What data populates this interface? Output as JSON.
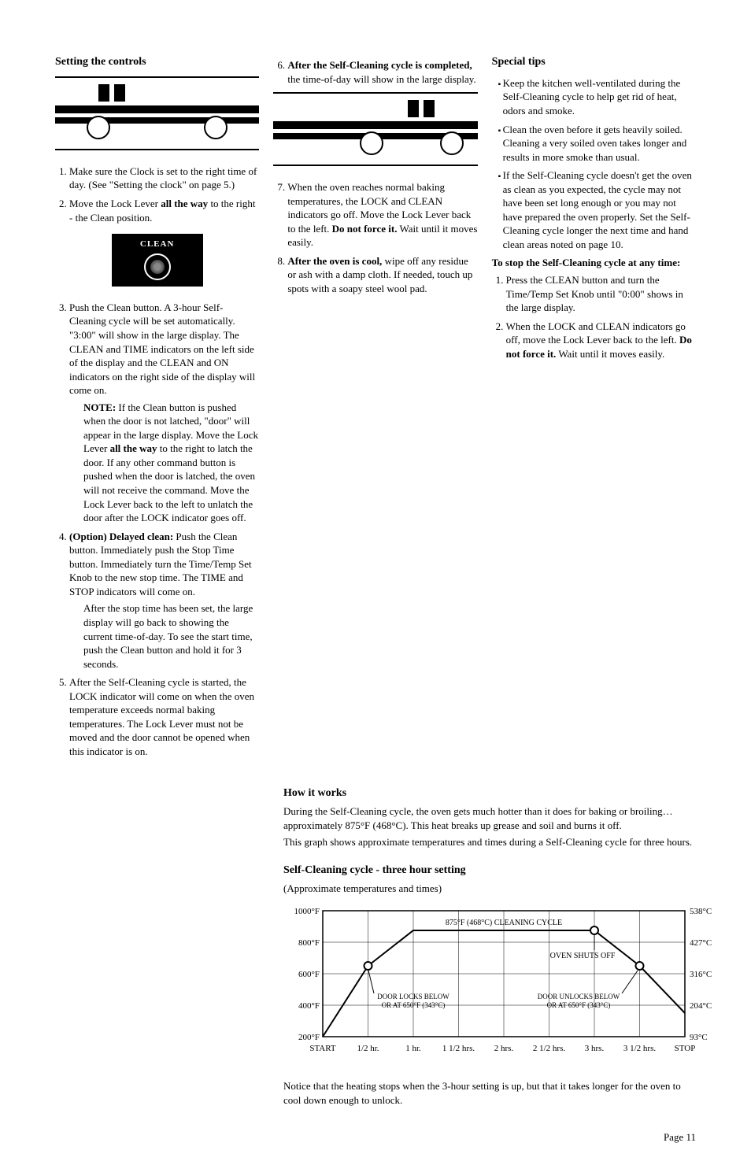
{
  "page_number": "Page 11",
  "col1": {
    "heading": "Setting the controls",
    "step1": "Make sure the Clock is set to the right time of day. (See \"Setting the clock\" on page 5.)",
    "step2_a": "Move the Lock Lever ",
    "step2_b": "all the way",
    "step2_c": " to the right - the Clean position.",
    "clean_label": "CLEAN",
    "step3": "Push the Clean button. A 3-hour Self-Cleaning cycle will be set automatically. \"3:00\" will show in the large display. The CLEAN and TIME indicators on the left side of the display and the CLEAN and ON indicators on the right side of the display will come on.",
    "step3_note_a": "NOTE:",
    "step3_note_b": " If the Clean button is pushed when the door is not latched, \"door\" will appear in the large display. Move the Lock Lever ",
    "step3_note_c": "all the way",
    "step3_note_d": " to the right to latch the door. If any other command button is pushed when the door is latched, the oven will not receive the command. Move the Lock Lever back to the left to unlatch the door after the LOCK indicator goes off.",
    "step4_a": "(Option) Delayed clean:",
    "step4_b": " Push the Clean button. Immediately push the Stop Time button. Immediately turn the Time/Temp Set Knob to the new stop time. The TIME and STOP indicators will come on.",
    "step4_c": "After the stop time has been set, the large display will go back to showing the current time-of-day. To see the start time, push the Clean button and hold it for 3 seconds.",
    "step5": "After the Self-Cleaning cycle is started, the LOCK indicator will come on when the oven temperature exceeds normal baking temperatures. The Lock Lever must not be moved and the door cannot be opened when this indicator is on."
  },
  "col2": {
    "step6_a": "After the Self-Cleaning cycle is completed,",
    "step6_b": " the time-of-day will show in the large display.",
    "step7_a": "When the oven reaches normal baking temperatures, the LOCK and CLEAN indicators go off. Move the Lock Lever back to the left. ",
    "step7_b": "Do not force it.",
    "step7_c": " Wait until it moves easily.",
    "step8_a": "After the oven is cool,",
    "step8_b": " wipe off any residue or ash with a damp cloth. If needed, touch up spots with a soapy steel wool pad."
  },
  "col3": {
    "heading": "Special tips",
    "tip1": "Keep the kitchen well-ventilated during the Self-Cleaning cycle to help get rid of heat, odors and smoke.",
    "tip2": "Clean the oven before it gets heavily soiled. Cleaning a very soiled oven takes longer and results in more smoke than usual.",
    "tip3": "If the Self-Cleaning cycle doesn't get the oven as clean as you expected, the cycle may not have been set long enough or you may not have prepared the oven properly. Set the Self-Cleaning cycle longer the next time and hand clean areas noted on page 10.",
    "stop_heading": "To stop the Self-Cleaning cycle at any time:",
    "stop1": "Press the CLEAN button and turn the Time/Temp Set Knob until \"0:00\" shows in the large display.",
    "stop2_a": "When the LOCK and CLEAN indicators go off, move the Lock Lever back to the left. ",
    "stop2_b": "Do not force it.",
    "stop2_c": " Wait until it moves easily."
  },
  "lower": {
    "how_heading": "How it works",
    "how_p1": "During the Self-Cleaning cycle, the oven gets much hotter than it does for baking or broiling…approximately 875°F (468°C). This heat breaks up grease and soil and burns it off.",
    "how_p2": "This graph shows approximate temperatures and times during a Self-Cleaning cycle for three hours.",
    "chart_title": "Self-Cleaning cycle - three hour setting",
    "chart_sub": "(Approximate temperatures and times)",
    "notice": "Notice that the heating stops when the 3-hour setting is up, but that it takes longer for the oven to cool down enough to unlock."
  },
  "chart_data": {
    "type": "line",
    "title": "Self-Cleaning cycle - three hour setting",
    "xlabel": "Time",
    "ylabel_left": "°F",
    "ylabel_right": "°C",
    "y_ticks_f": [
      "200°F",
      "400°F",
      "600°F",
      "800°F",
      "1000°F"
    ],
    "y_ticks_c": [
      "93°C",
      "204°C",
      "316°C",
      "427°C",
      "538°C"
    ],
    "x_ticks": [
      "START",
      "1/2 hr.",
      "1 hr.",
      "1 1/2 hrs.",
      "2 hrs.",
      "2 1/2 hrs.",
      "3 hrs.",
      "3 1/2 hrs.",
      "STOP"
    ],
    "ylim_f": [
      0,
      1000
    ],
    "series": [
      {
        "name": "Oven temperature",
        "points": [
          {
            "x": "START",
            "f": 70
          },
          {
            "x": "1/2 hr.",
            "f": 650
          },
          {
            "x": "1 hr.",
            "f": 875
          },
          {
            "x": "1 1/2 hrs.",
            "f": 875
          },
          {
            "x": "2 hrs.",
            "f": 875
          },
          {
            "x": "2 1/2 hrs.",
            "f": 875
          },
          {
            "x": "3 hrs.",
            "f": 875
          },
          {
            "x": "3 1/2 hrs.",
            "f": 650
          },
          {
            "x": "STOP",
            "f": 350
          }
        ]
      }
    ],
    "annotations": [
      {
        "text": "875°F (468°C) CLEANING CYCLE",
        "approx_x": "1 1/2 hrs.",
        "approx_f": 900
      },
      {
        "text": "DOOR LOCKS BELOW OR AT 650°F (343°C)",
        "approx_x": "1/2 hr.",
        "approx_f": 400,
        "marker_f": 650
      },
      {
        "text": "OVEN SHUTS OFF",
        "approx_x": "3 hrs.",
        "approx_f": 700,
        "marker_f": 875
      },
      {
        "text": "DOOR UNLOCKS BELOW OR AT 650°F (343°C)",
        "approx_x": "3 1/2 hrs.",
        "approx_f": 400,
        "marker_f": 650
      }
    ]
  }
}
